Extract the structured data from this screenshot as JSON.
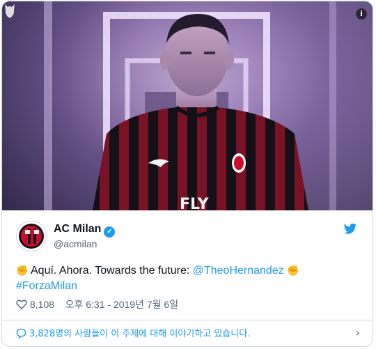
{
  "tweet": {
    "account_name": "AC Milan",
    "handle": "@acmilan",
    "text_part1": "Aquí. Ahora. Towards the future: ",
    "mention": "@TheoHernandez",
    "hashtag": "#ForzaMilan",
    "like_count": "8,108",
    "timestamp": "오후 6:31 - 2019년 7월 6일",
    "info_label": "i",
    "verified_glyph": "✓"
  },
  "footer": {
    "discussion_text": "3,828명의 사람들이 이 주제에 대해 이야기하고 있습니다.",
    "chevron": "›"
  },
  "media": {
    "jersey_sponsor": "FLY"
  },
  "colors": {
    "link": "#1d9bf0",
    "text": "#0f1419",
    "muted": "#536471",
    "milan_red": "#c8102e"
  }
}
